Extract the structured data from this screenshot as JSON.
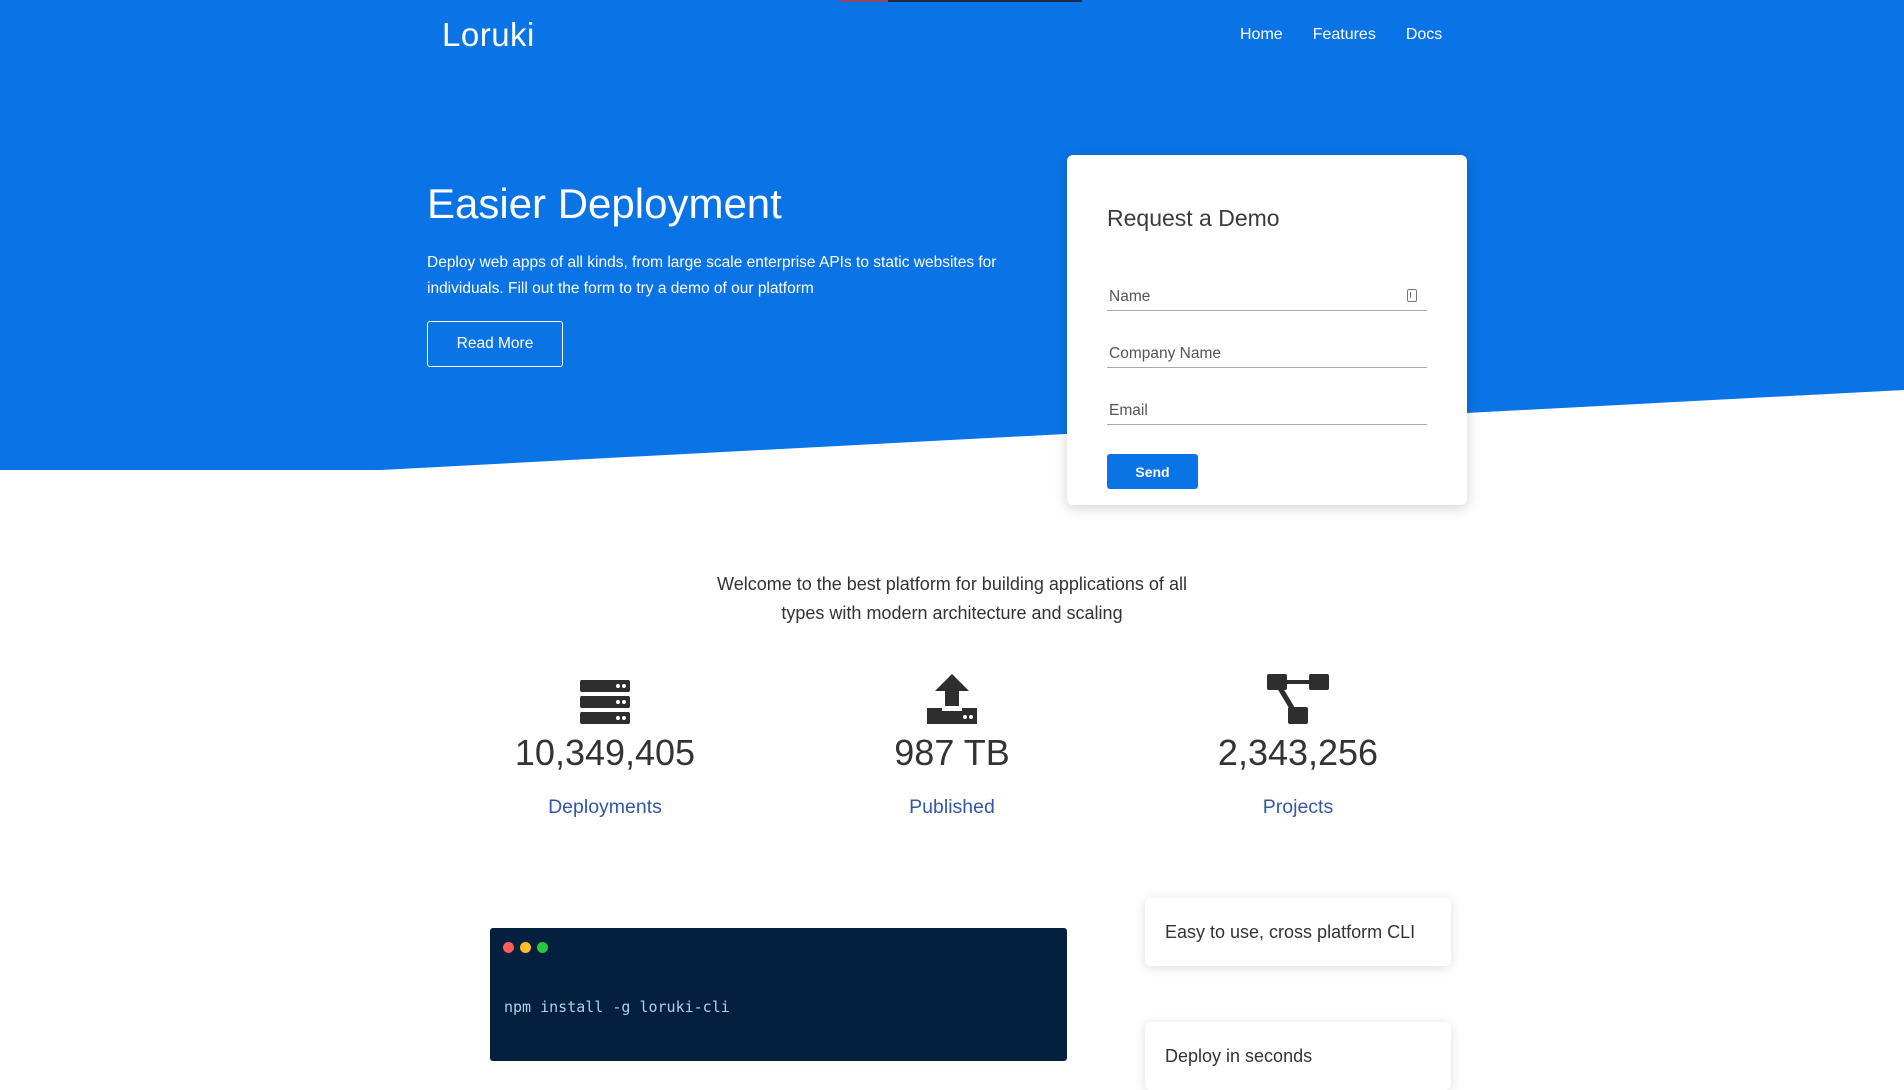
{
  "header": {
    "logo": "Loruki",
    "nav": [
      {
        "label": "Home"
      },
      {
        "label": "Features"
      },
      {
        "label": "Docs"
      }
    ]
  },
  "hero": {
    "title": "Easier Deployment",
    "description": "Deploy web apps of all kinds, from large scale enterprise APIs to static websites for individuals. Fill out the form to try a demo of our platform",
    "read_more_label": "Read More"
  },
  "demo_form": {
    "title": "Request a Demo",
    "name_placeholder": "Name",
    "company_placeholder": "Company Name",
    "email_placeholder": "Email",
    "send_label": "Send"
  },
  "welcome": {
    "text": "Welcome to the best platform for building applications of all types with modern architecture and scaling"
  },
  "stats": [
    {
      "icon": "server-icon",
      "value": "10,349,405",
      "label": "Deployments"
    },
    {
      "icon": "upload-icon",
      "value": "987 TB",
      "label": "Published"
    },
    {
      "icon": "project-diagram-icon",
      "value": "2,343,256",
      "label": "Projects"
    }
  ],
  "terminal": {
    "command": "npm install -g loruki-cli"
  },
  "features": [
    {
      "label": "Easy to use, cross platform CLI"
    },
    {
      "label": "Deploy in seconds"
    }
  ],
  "colors": {
    "primary": "#0a74e6",
    "terminal_bg": "#051f3e",
    "stat_label": "#3457a8"
  }
}
